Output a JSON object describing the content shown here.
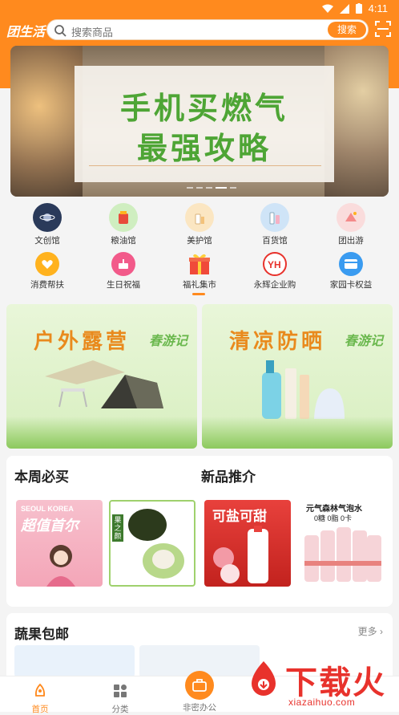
{
  "statusbar": {
    "time": "4:11"
  },
  "header": {
    "logo": "团生活",
    "search_placeholder": "搜索商品",
    "search_button": "搜索"
  },
  "banner": {
    "line1": "手机买燃气",
    "line2": "最强攻略"
  },
  "categories": [
    {
      "label": "文创馆",
      "icon": "planet-icon",
      "color": "#2a3a5a"
    },
    {
      "label": "粮油馆",
      "icon": "grocery-icon",
      "color": "#8fcf6f"
    },
    {
      "label": "美护馆",
      "icon": "cosmetics-icon",
      "color": "#f6d7a7"
    },
    {
      "label": "百货馆",
      "icon": "bottles-icon",
      "color": "#9fc9ef"
    },
    {
      "label": "团出游",
      "icon": "travel-icon",
      "color": "#f5c7c7"
    },
    {
      "label": "消费帮扶",
      "icon": "heart-hands-icon",
      "color": "#ffb21e"
    },
    {
      "label": "生日祝福",
      "icon": "cake-icon",
      "color": "#f25a8a"
    },
    {
      "label": "福礼集市",
      "icon": "gift-icon",
      "color": "#f04a3a"
    },
    {
      "label": "永辉企业购",
      "icon": "yh-logo-icon",
      "color": "#e8322c"
    },
    {
      "label": "家园卡权益",
      "icon": "card-icon",
      "color": "#3a9bf0"
    }
  ],
  "promos": [
    {
      "title": "户外露营",
      "brand": "春游记"
    },
    {
      "title": "清凉防晒",
      "brand": "春游记"
    }
  ],
  "weekly": {
    "title": "本周必买",
    "items": [
      {
        "name": "seoul-korea-product",
        "texts": [
          "SEOUL KOREA",
          "超值首尔"
        ]
      },
      {
        "name": "mochi-product",
        "texts": [
          "果之颜"
        ]
      }
    ]
  },
  "new_arrivals": {
    "title": "新品推介",
    "items": [
      {
        "name": "lychee-drink-product",
        "texts": [
          "可盐可甜"
        ]
      },
      {
        "name": "sparkling-water-product",
        "texts": [
          "元气森林气泡水",
          "0糖 0脂 0卡"
        ]
      }
    ]
  },
  "fruit_section": {
    "title": "蔬果包邮",
    "more": "更多"
  },
  "tabbar": [
    {
      "label": "首页",
      "icon": "home-icon",
      "active": true
    },
    {
      "label": "分类",
      "icon": "category-icon",
      "active": false
    },
    {
      "label": "非密办公",
      "icon": "briefcase-icon",
      "active": false
    }
  ],
  "watermark": {
    "text": "下载火",
    "url": "xiazaihuo.com"
  },
  "colors": {
    "brand": "#ff8a1e",
    "green_title": "#4ea535"
  }
}
